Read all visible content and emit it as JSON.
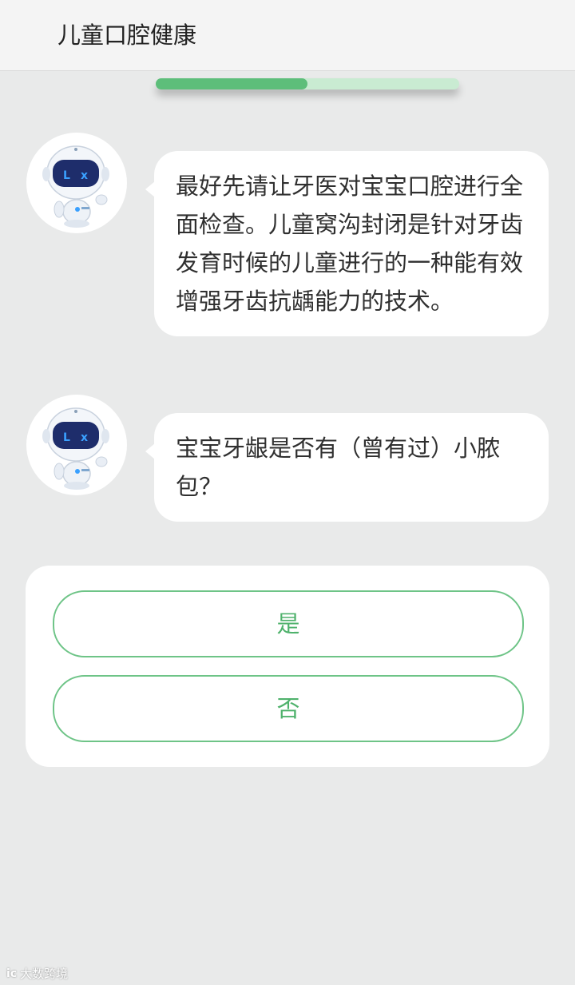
{
  "header": {
    "title": "儿童口腔健康"
  },
  "progress": {
    "fraction": 0.5
  },
  "messages": [
    {
      "text": "最好先请让牙医对宝宝口腔进行全面检查。儿童窝沟封闭是针对牙齿发育时候的儿童进行的一种能有效增强牙齿抗龋能力的技术。"
    },
    {
      "text": "宝宝牙龈是否有（曾有过）小脓包？"
    }
  ],
  "options": {
    "yes_label": "是",
    "no_label": "否"
  },
  "watermark": {
    "logo": "ic",
    "text": "大数跨境"
  },
  "colors": {
    "background": "#e9eaea",
    "accent_green": "#5dbe7a",
    "progress_track": "#c9ebd2",
    "option_border": "#6ec487",
    "option_text": "#4fb26c",
    "robot_screen": "#1e2d6b",
    "robot_eyes": "#3aa0ff"
  },
  "icons": {
    "avatar": "robot-avatar-icon"
  }
}
